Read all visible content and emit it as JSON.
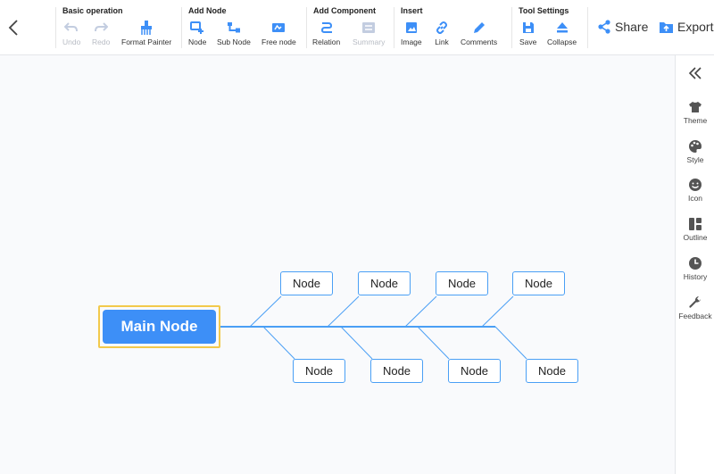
{
  "toolbar": {
    "groups": [
      {
        "title": "Basic operation",
        "tools": [
          "Undo",
          "Redo",
          "Format Painter"
        ]
      },
      {
        "title": "Add Node",
        "tools": [
          "Node",
          "Sub Node",
          "Free node"
        ]
      },
      {
        "title": "Add Component",
        "tools": [
          "Relation",
          "Summary"
        ]
      },
      {
        "title": "Insert",
        "tools": [
          "Image",
          "Link",
          "Comments"
        ]
      },
      {
        "title": "Tool Settings",
        "tools": [
          "Save",
          "Collapse"
        ]
      }
    ],
    "share_label": "Share",
    "export_label": "Export"
  },
  "canvas": {
    "main_node": "Main Node",
    "top_nodes": [
      "Node",
      "Node",
      "Node",
      "Node"
    ],
    "bottom_nodes": [
      "Node",
      "Node",
      "Node",
      "Node"
    ]
  },
  "sidebar": {
    "items": [
      "Theme",
      "Style",
      "Icon",
      "Outline",
      "History",
      "Feedback"
    ]
  },
  "colors": {
    "accent": "#3d8ff7",
    "main_border": "#f2c94c",
    "line": "#4a9ff5",
    "disabled": "#b8bcc4"
  },
  "icons": {
    "toolbar": [
      "undo-icon",
      "redo-icon",
      "format-painter-icon",
      "node-icon",
      "sub-node-icon",
      "free-node-icon",
      "relation-icon",
      "summary-icon",
      "image-icon",
      "link-icon",
      "comments-icon",
      "save-icon",
      "collapse-icon",
      "share-icon",
      "export-icon"
    ],
    "sidebar": [
      "theme-icon",
      "style-icon",
      "icon-icon",
      "outline-icon",
      "history-icon",
      "feedback-icon"
    ]
  }
}
